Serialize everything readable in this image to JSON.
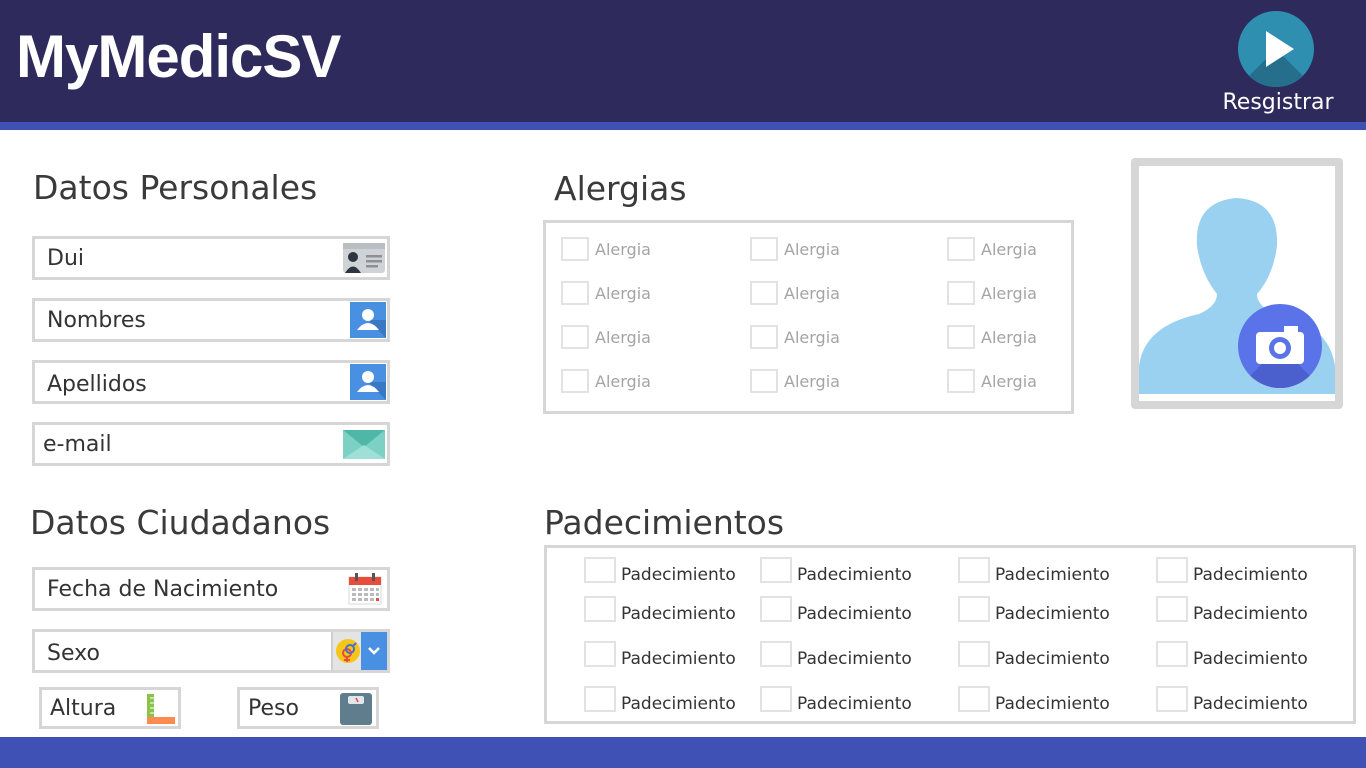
{
  "app": {
    "title": "MyMedicSV"
  },
  "header": {
    "register_label": "Resgistrar",
    "register_icon": "play-icon"
  },
  "personal": {
    "title": "Datos Personales",
    "fields": [
      {
        "label": "Dui",
        "icon": "id-card-icon"
      },
      {
        "label": "Nombres",
        "icon": "user-icon"
      },
      {
        "label": "Apellidos",
        "icon": "user-icon"
      },
      {
        "label": "e-mail",
        "icon": "envelope-icon"
      }
    ]
  },
  "citizen": {
    "title": "Datos Ciudadanos",
    "birth_label": "Fecha de Nacimiento",
    "birth_icon": "calendar-icon",
    "sex_label": "Sexo",
    "sex_icon": "gender-icon",
    "height_label": "Altura",
    "height_icon": "ruler-icon",
    "weight_label": "Peso",
    "weight_icon": "scale-icon"
  },
  "allergies": {
    "title": "Alergias",
    "items": [
      "Alergia",
      "Alergia",
      "Alergia",
      "Alergia",
      "Alergia",
      "Alergia",
      "Alergia",
      "Alergia",
      "Alergia",
      "Alergia",
      "Alergia",
      "Alergia"
    ]
  },
  "conditions": {
    "title": "Padecimientos",
    "items": [
      "Padecimiento",
      "Padecimiento",
      "Padecimiento",
      "Padecimiento",
      "Padecimiento",
      "Padecimiento",
      "Padecimiento",
      "Padecimiento",
      "Padecimiento",
      "Padecimiento",
      "Padecimiento",
      "Padecimiento",
      "Padecimiento",
      "Padecimiento",
      "Padecimiento",
      "Padecimiento"
    ]
  },
  "photo": {
    "icon": "avatar-silhouette-icon",
    "camera_icon": "camera-icon"
  },
  "colors": {
    "header_bg": "#2e2b5c",
    "accent": "#3f51b5",
    "register_btn": "#2f8fb0",
    "camera_btn": "#5b73e8",
    "avatar": "#9ad1f0"
  }
}
